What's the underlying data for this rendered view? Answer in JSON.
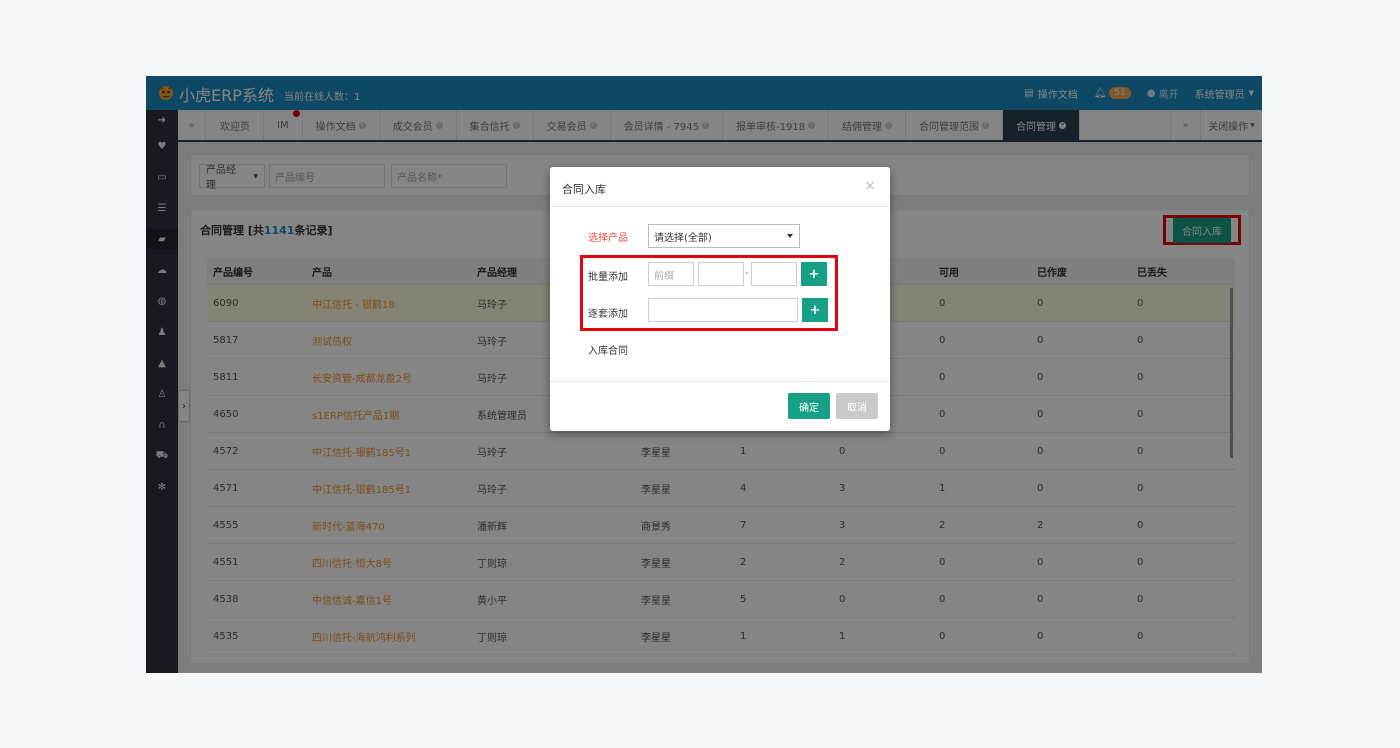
{
  "header": {
    "app_title": "小虎ERP系统",
    "online_users": "当前在线人数：1",
    "docs_label": "操作文档",
    "notification_count": "51",
    "leave_label": "离开",
    "user_label": "系统管理员"
  },
  "tabs": {
    "items": [
      "欢迎页",
      "IM",
      "操作文档",
      "成交会员",
      "集合信托",
      "交易会员",
      "会员详情 - 7945",
      "报单审核-1918",
      "结佣管理",
      "合同管理范围",
      "合同管理"
    ],
    "prev": "«",
    "next": "»",
    "close_ops": "关闭操作"
  },
  "filter": {
    "manager_select": "产品经理",
    "product_code_placeholder": "产品编号",
    "product_name_placeholder": "产品名称*"
  },
  "panel": {
    "title_prefix": "合同管理 [共",
    "total": "1141",
    "title_suffix": "条记录]",
    "add_button": "合同入库"
  },
  "table": {
    "columns": [
      "产品编号",
      "产品",
      "产品经理",
      "",
      "",
      "",
      "可用",
      "已作废",
      "已丢失"
    ],
    "rows": [
      [
        "6090",
        "中江信托 - 银鹤18",
        "马玲子",
        "",
        "",
        "",
        "0",
        "0",
        "0"
      ],
      [
        "5817",
        "测试债权",
        "马玲子",
        "",
        "",
        "",
        "0",
        "0",
        "0"
      ],
      [
        "5811",
        "长安资管-成都龙盈2号",
        "马玲子",
        "",
        "",
        "",
        "0",
        "0",
        "0"
      ],
      [
        "4650",
        "s1ERP信托产品1期",
        "系统管理员",
        "",
        "",
        "",
        "0",
        "0",
        "0"
      ],
      [
        "4572",
        "中江信托-银鹤185号1",
        "马玲子",
        "李星星",
        "1",
        "0",
        "0",
        "0",
        "0"
      ],
      [
        "4571",
        "中江信托-银鹤185号1",
        "马玲子",
        "李星星",
        "4",
        "3",
        "1",
        "0",
        "0"
      ],
      [
        "4555",
        "新时代-蓝海470",
        "潘新辉",
        "商景秀",
        "7",
        "3",
        "2",
        "2",
        "0"
      ],
      [
        "4551",
        "四川信托-恒大8号",
        "丁则琼",
        "李星星",
        "2",
        "2",
        "0",
        "0",
        "0"
      ],
      [
        "4538",
        "中信信诚-嘉信1号",
        "黄小平",
        "李星星",
        "5",
        "0",
        "0",
        "0",
        "0"
      ],
      [
        "4535",
        "四川信托-海航鸿利系列",
        "丁则琼",
        "李星星",
        "1",
        "1",
        "0",
        "0",
        "0"
      ]
    ]
  },
  "modal": {
    "title": "合同入库",
    "select_product_label": "选择产品",
    "select_product_value": "请选择(全部)",
    "batch_label": "批量添加",
    "prefix_placeholder": "前缀",
    "dash": "-",
    "single_label": "逐套添加",
    "stock_label": "入库合同",
    "ok": "确定",
    "cancel": "取消",
    "plus": "+",
    "close": "×"
  }
}
